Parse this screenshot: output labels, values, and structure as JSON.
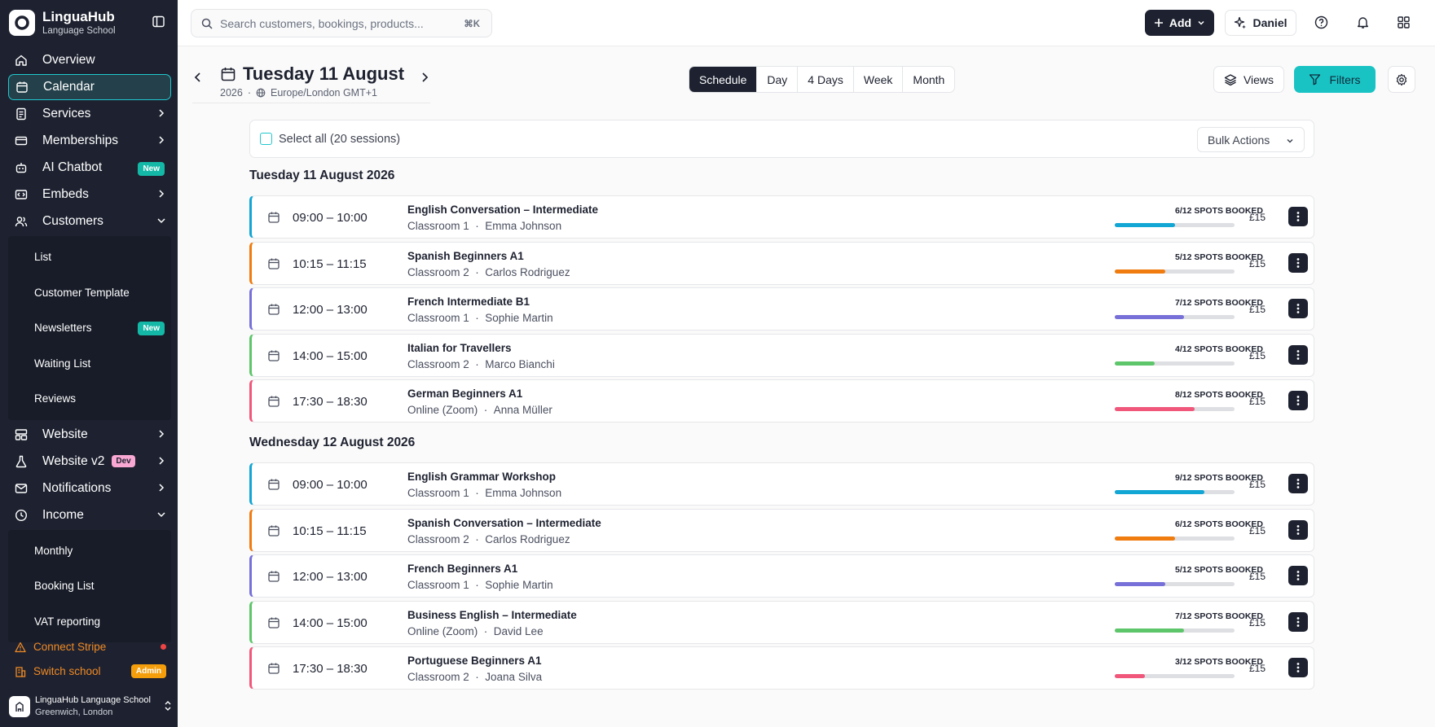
{
  "brand": {
    "name": "LinguaHub",
    "subtitle": "Language School"
  },
  "sidebar": {
    "items": [
      {
        "label": "Overview",
        "icon": "home-icon"
      },
      {
        "label": "Calendar",
        "icon": "calendar-icon",
        "active": true
      },
      {
        "label": "Services",
        "icon": "services-icon"
      },
      {
        "label": "Memberships",
        "icon": "card-icon"
      },
      {
        "label": "AI Chatbot",
        "icon": "bot-icon",
        "badge": "New"
      },
      {
        "label": "Embeds",
        "icon": "embed-icon"
      },
      {
        "label": "Customers",
        "icon": "users-icon",
        "expanded": true
      }
    ],
    "customers_sub": [
      {
        "label": "List"
      },
      {
        "label": "Customer Template"
      },
      {
        "label": "Newsletters",
        "badge": "New"
      },
      {
        "label": "Waiting List"
      },
      {
        "label": "Reviews"
      }
    ],
    "items2": [
      {
        "label": "Website",
        "icon": "website-icon"
      },
      {
        "label": "Website v2",
        "icon": "flask-icon",
        "badge": "Dev"
      },
      {
        "label": "Notifications",
        "icon": "mail-icon"
      },
      {
        "label": "Income",
        "icon": "clock-icon",
        "expanded": true
      }
    ],
    "income_sub": [
      {
        "label": "Monthly"
      },
      {
        "label": "Booking List"
      },
      {
        "label": "VAT reporting"
      }
    ],
    "connect_stripe": "Connect Stripe",
    "switch_school": "Switch school",
    "admin_badge": "Admin",
    "school": {
      "name": "LinguaHub Language School",
      "location": "Greenwich, London"
    }
  },
  "topbar": {
    "search_placeholder": "Search customers, bookings, products...",
    "search_shortcut": "⌘K",
    "add_label": "Add",
    "user_label": "Daniel"
  },
  "header": {
    "date_title": "Tuesday 11 August",
    "year": "2026",
    "timezone": "Europe/London GMT+1",
    "tabs": [
      {
        "label": "Schedule",
        "active": true
      },
      {
        "label": "Day"
      },
      {
        "label": "4 Days"
      },
      {
        "label": "Week"
      },
      {
        "label": "Month"
      }
    ],
    "views_label": "Views",
    "filters_label": "Filters"
  },
  "list": {
    "select_all": "Select all (20 sessions)",
    "bulk_actions": "Bulk Actions"
  },
  "days": [
    {
      "title": "Tuesday 11 August 2026",
      "sessions": [
        {
          "time": "09:00 – 10:00",
          "title": "English Conversation – Intermediate",
          "room": "Classroom 1",
          "teacher": "Emma Johnson",
          "spots": "6/12 SPOTS BOOKED",
          "fill": 0.5,
          "price": "£15",
          "color": "#12a6d4"
        },
        {
          "time": "10:15 – 11:15",
          "title": "Spanish Beginners A1",
          "room": "Classroom 2",
          "teacher": "Carlos Rodriguez",
          "spots": "5/12 SPOTS BOOKED",
          "fill": 0.42,
          "price": "£15",
          "color": "#f07b0e"
        },
        {
          "time": "12:00 – 13:00",
          "title": "French Intermediate B1",
          "room": "Classroom 1",
          "teacher": "Sophie Martin",
          "spots": "7/12 SPOTS BOOKED",
          "fill": 0.58,
          "price": "£15",
          "color": "#7670d8"
        },
        {
          "time": "14:00 – 15:00",
          "title": "Italian for Travellers",
          "room": "Classroom 2",
          "teacher": "Marco Bianchi",
          "spots": "4/12 SPOTS BOOKED",
          "fill": 0.33,
          "price": "£15",
          "color": "#5ec66a"
        },
        {
          "time": "17:30 – 18:30",
          "title": "German Beginners A1",
          "room": "Online (Zoom)",
          "teacher": "Anna Müller",
          "spots": "8/12 SPOTS BOOKED",
          "fill": 0.67,
          "price": "£15",
          "color": "#f0577a"
        }
      ]
    },
    {
      "title": "Wednesday 12 August 2026",
      "sessions": [
        {
          "time": "09:00 – 10:00",
          "title": "English Grammar Workshop",
          "room": "Classroom 1",
          "teacher": "Emma Johnson",
          "spots": "9/12 SPOTS BOOKED",
          "fill": 0.75,
          "price": "£15",
          "color": "#12a6d4"
        },
        {
          "time": "10:15 – 11:15",
          "title": "Spanish Conversation – Intermediate",
          "room": "Classroom 2",
          "teacher": "Carlos Rodriguez",
          "spots": "6/12 SPOTS BOOKED",
          "fill": 0.5,
          "price": "£15",
          "color": "#f07b0e"
        },
        {
          "time": "12:00 – 13:00",
          "title": "French Beginners A1",
          "room": "Classroom 1",
          "teacher": "Sophie Martin",
          "spots": "5/12 SPOTS BOOKED",
          "fill": 0.42,
          "price": "£15",
          "color": "#7670d8"
        },
        {
          "time": "14:00 – 15:00",
          "title": "Business English – Intermediate",
          "room": "Online (Zoom)",
          "teacher": "David Lee",
          "spots": "7/12 SPOTS BOOKED",
          "fill": 0.58,
          "price": "£15",
          "color": "#5ec66a"
        },
        {
          "time": "17:30 – 18:30",
          "title": "Portuguese Beginners A1",
          "room": "Classroom 2",
          "teacher": "Joana Silva",
          "spots": "3/12 SPOTS BOOKED",
          "fill": 0.25,
          "price": "£15",
          "color": "#f0577a"
        }
      ]
    }
  ],
  "colors": {
    "accent": "#19c3c4",
    "dark": "#1e2230"
  }
}
